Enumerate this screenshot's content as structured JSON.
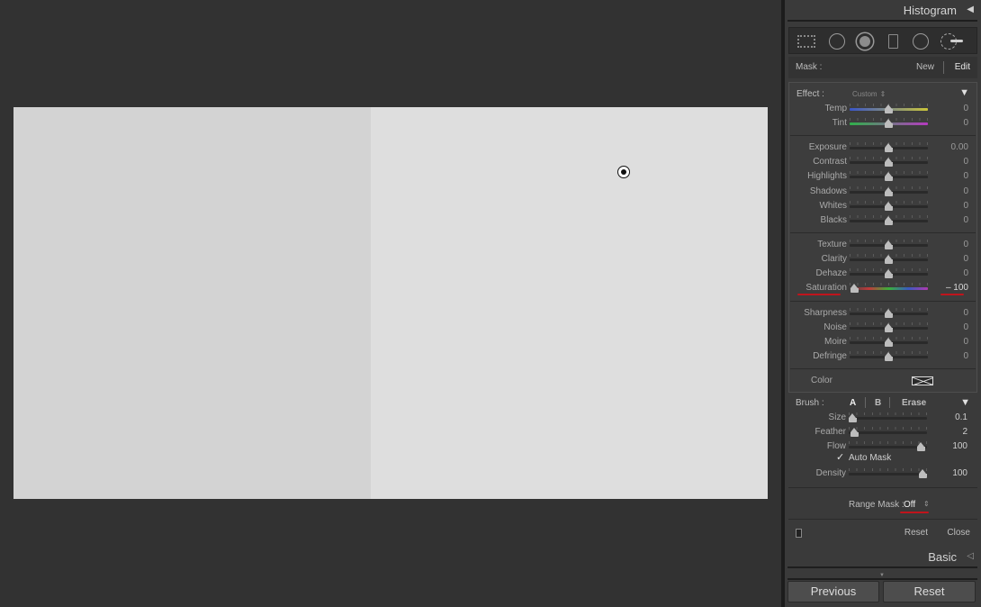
{
  "panel": {
    "histogram_title": "Histogram",
    "mask": {
      "label": "Mask :",
      "new": "New",
      "edit": "Edit"
    },
    "effect": {
      "label": "Effect :",
      "preset": "Custom",
      "sliders": [
        {
          "label": "Temp",
          "value": "0"
        },
        {
          "label": "Tint",
          "value": "0"
        },
        {
          "label": "Exposure",
          "value": "0.00"
        },
        {
          "label": "Contrast",
          "value": "0"
        },
        {
          "label": "Highlights",
          "value": "0"
        },
        {
          "label": "Shadows",
          "value": "0"
        },
        {
          "label": "Whites",
          "value": "0"
        },
        {
          "label": "Blacks",
          "value": "0"
        },
        {
          "label": "Texture",
          "value": "0"
        },
        {
          "label": "Clarity",
          "value": "0"
        },
        {
          "label": "Dehaze",
          "value": "0"
        },
        {
          "label": "Saturation",
          "value": "– 100"
        },
        {
          "label": "Sharpness",
          "value": "0"
        },
        {
          "label": "Noise",
          "value": "0"
        },
        {
          "label": "Moire",
          "value": "0"
        },
        {
          "label": "Defringe",
          "value": "0"
        }
      ],
      "color_label": "Color"
    },
    "brush": {
      "label": "Brush :",
      "a": "A",
      "b": "B",
      "erase": "Erase",
      "sliders": [
        {
          "label": "Size",
          "value": "0.1"
        },
        {
          "label": "Feather",
          "value": "2"
        },
        {
          "label": "Flow",
          "value": "100"
        },
        {
          "label": "Density",
          "value": "100"
        }
      ],
      "auto_mask": "Auto Mask"
    },
    "range_mask": {
      "label": "Range Mask :",
      "value": "Off"
    },
    "bottom": {
      "reset": "Reset",
      "close": "Close"
    },
    "basic_title": "Basic",
    "buttons": {
      "previous": "Previous",
      "reset": "Reset"
    }
  },
  "colors": {
    "highlight": "#c0141c",
    "panel_bg": "#3a3a3a",
    "canvas_bg": "#323232"
  }
}
